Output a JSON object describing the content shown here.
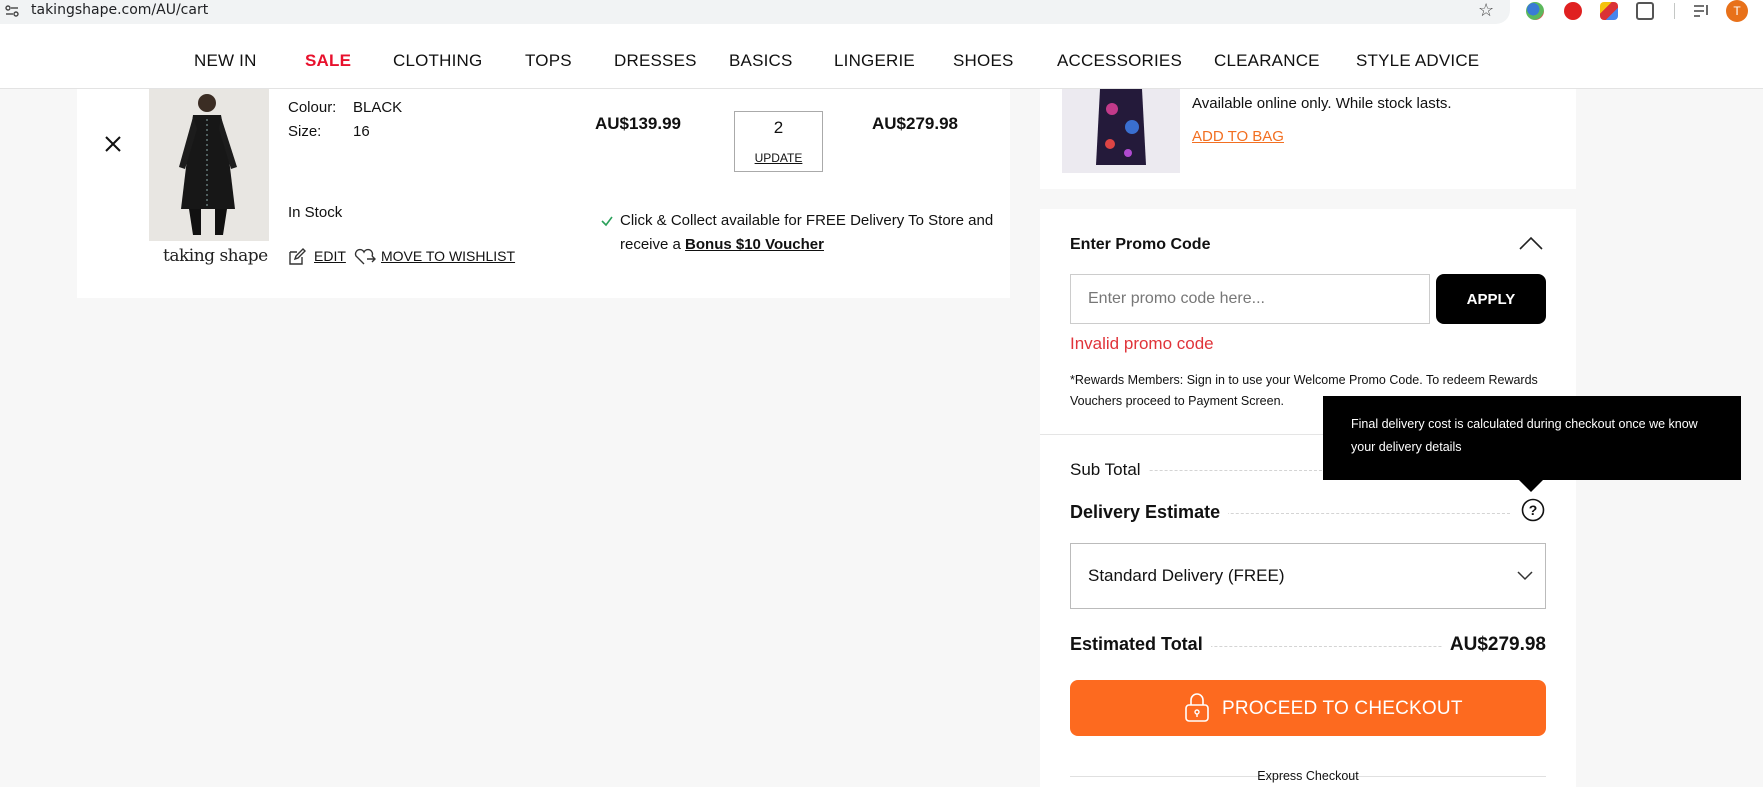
{
  "browser": {
    "url": "takingshape.com/AU/cart",
    "profile_initial": "T",
    "icons": [
      "site-info-icon",
      "bookmark-star-icon",
      "extension-icons",
      "reading-list-icon",
      "profile-avatar"
    ]
  },
  "nav": {
    "items": [
      "NEW IN",
      "SALE",
      "CLOTHING",
      "TOPS",
      "DRESSES",
      "BASICS",
      "LINGERIE",
      "SHOES",
      "ACCESSORIES",
      "CLEARANCE",
      "STYLE ADVICE"
    ],
    "sale_color": "#e8112d"
  },
  "cart_item": {
    "colour_label": "Colour:",
    "colour_value": "BLACK",
    "size_label": "Size:",
    "size_value": "16",
    "unit_price": "AU$139.99",
    "quantity": "2",
    "update_label": "UPDATE",
    "line_total": "AU$279.98",
    "stock_status": "In Stock",
    "brand_logo": "taking shape",
    "edit_label": "EDIT",
    "wishlist_label": "MOVE TO WISHLIST",
    "collect_text": "Click & Collect available for FREE Delivery To Store and receive a ",
    "collect_voucher": "Bonus $10 Voucher"
  },
  "upsell": {
    "note": "Available online only. While stock lasts.",
    "add_label": "ADD TO BAG",
    "accent": "#f26f21"
  },
  "promo": {
    "title": "Enter Promo Code",
    "placeholder": "Enter promo code here...",
    "apply_label": "APPLY",
    "error": "Invalid promo code",
    "rewards_note": "*Rewards Members: Sign in to use your Welcome Promo Code. To redeem Rewards Vouchers proceed to Payment Screen."
  },
  "summary": {
    "subtotal_label": "Sub Total",
    "delivery_label": "Delivery Estimate",
    "delivery_option": "Standard Delivery (FREE)",
    "estimated_total_label": "Estimated Total",
    "estimated_total": "AU$279.98",
    "checkout_label": "PROCEED TO CHECKOUT",
    "checkout_color": "#fd6a1f",
    "express_label": "Express Checkout"
  },
  "tooltip": {
    "text": "Final delivery cost is calculated during checkout once we know your delivery details"
  }
}
